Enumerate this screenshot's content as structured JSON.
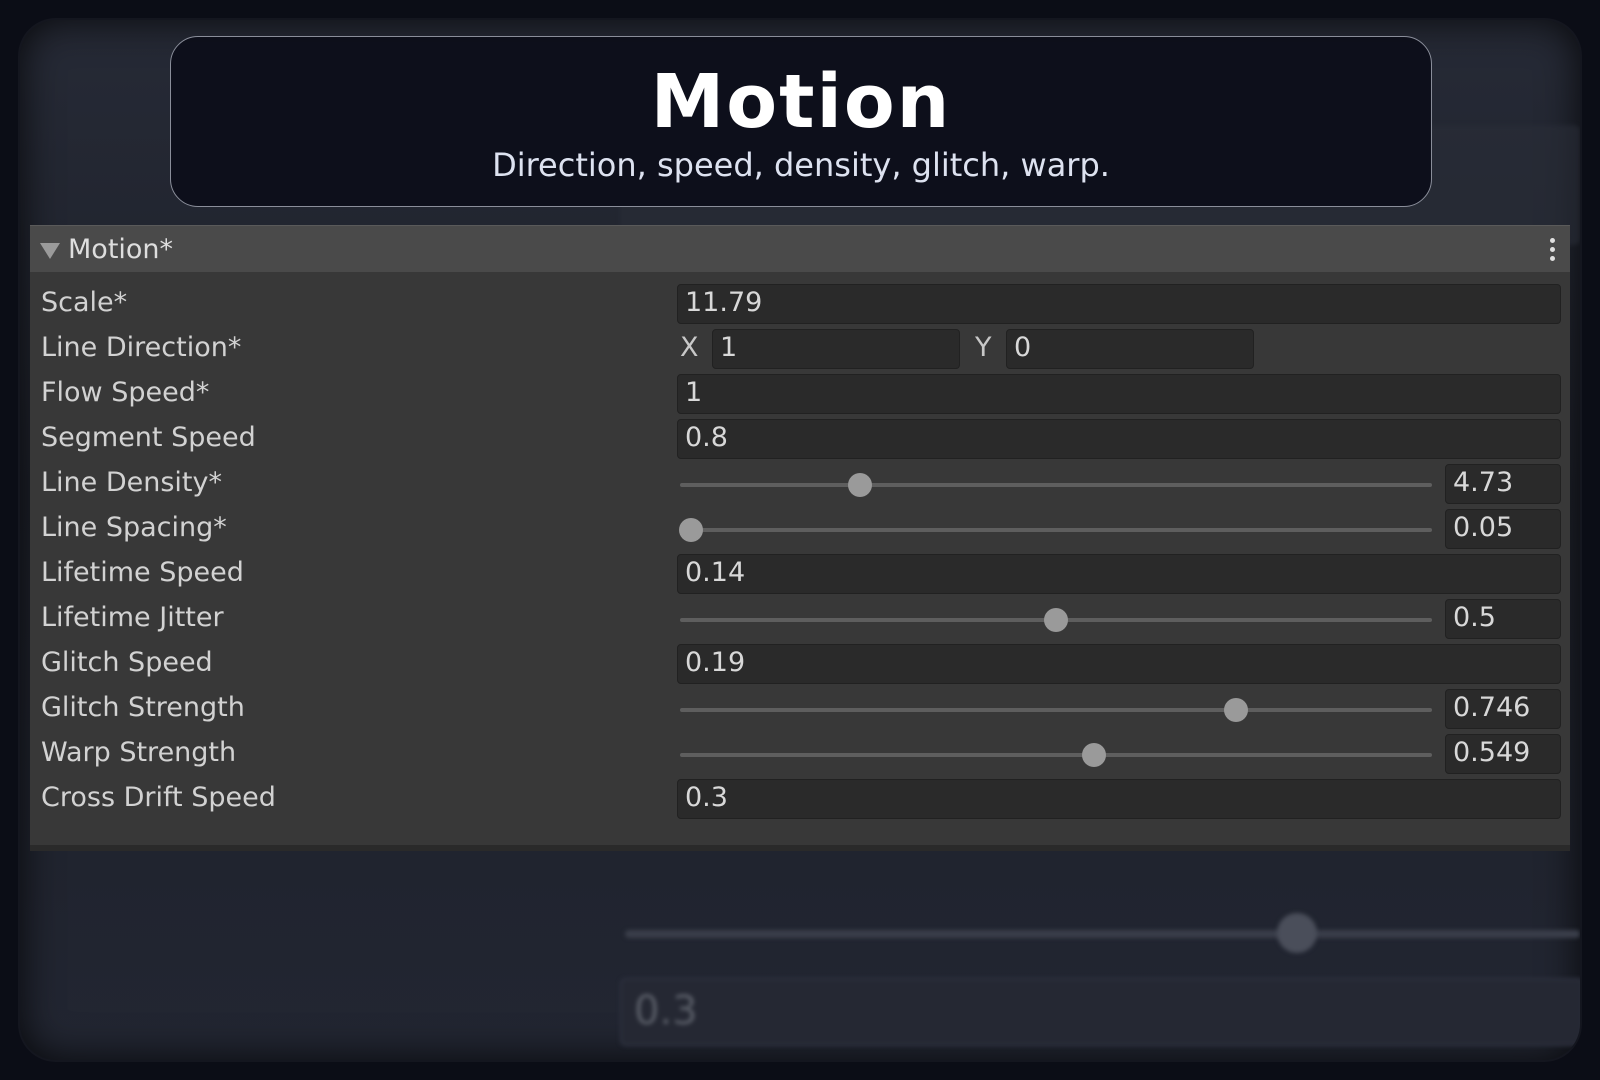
{
  "header": {
    "title": "Motion",
    "subtitle": "Direction, speed, density, glitch, warp."
  },
  "section": {
    "title": "Motion*"
  },
  "fields": {
    "scale": {
      "label": "Scale*",
      "value": "11.79"
    },
    "line_direction": {
      "label": "Line Direction*",
      "x_label": "X",
      "x": "1",
      "y_label": "Y",
      "y": "0"
    },
    "flow_speed": {
      "label": "Flow Speed*",
      "value": "1"
    },
    "segment_speed": {
      "label": "Segment Speed",
      "value": "0.8"
    },
    "line_density": {
      "label": "Line Density*",
      "value": "4.73",
      "slider_position": 0.24
    },
    "line_spacing": {
      "label": "Line Spacing*",
      "value": "0.05",
      "slider_position": 0.015
    },
    "lifetime_speed": {
      "label": "Lifetime Speed",
      "value": "0.14"
    },
    "lifetime_jitter": {
      "label": "Lifetime Jitter",
      "value": "0.5",
      "slider_position": 0.5
    },
    "glitch_speed": {
      "label": "Glitch Speed",
      "value": "0.19"
    },
    "glitch_strength": {
      "label": "Glitch Strength",
      "value": "0.746",
      "slider_position": 0.74
    },
    "warp_strength": {
      "label": "Warp Strength",
      "value": "0.549",
      "slider_position": 0.55
    },
    "cross_drift_speed": {
      "label": "Cross Drift Speed",
      "value": "0.3"
    }
  },
  "background_ghost": {
    "value": "0.3"
  },
  "icons": {
    "fold": "triangle-down-icon",
    "menu": "kebab-menu-icon"
  }
}
